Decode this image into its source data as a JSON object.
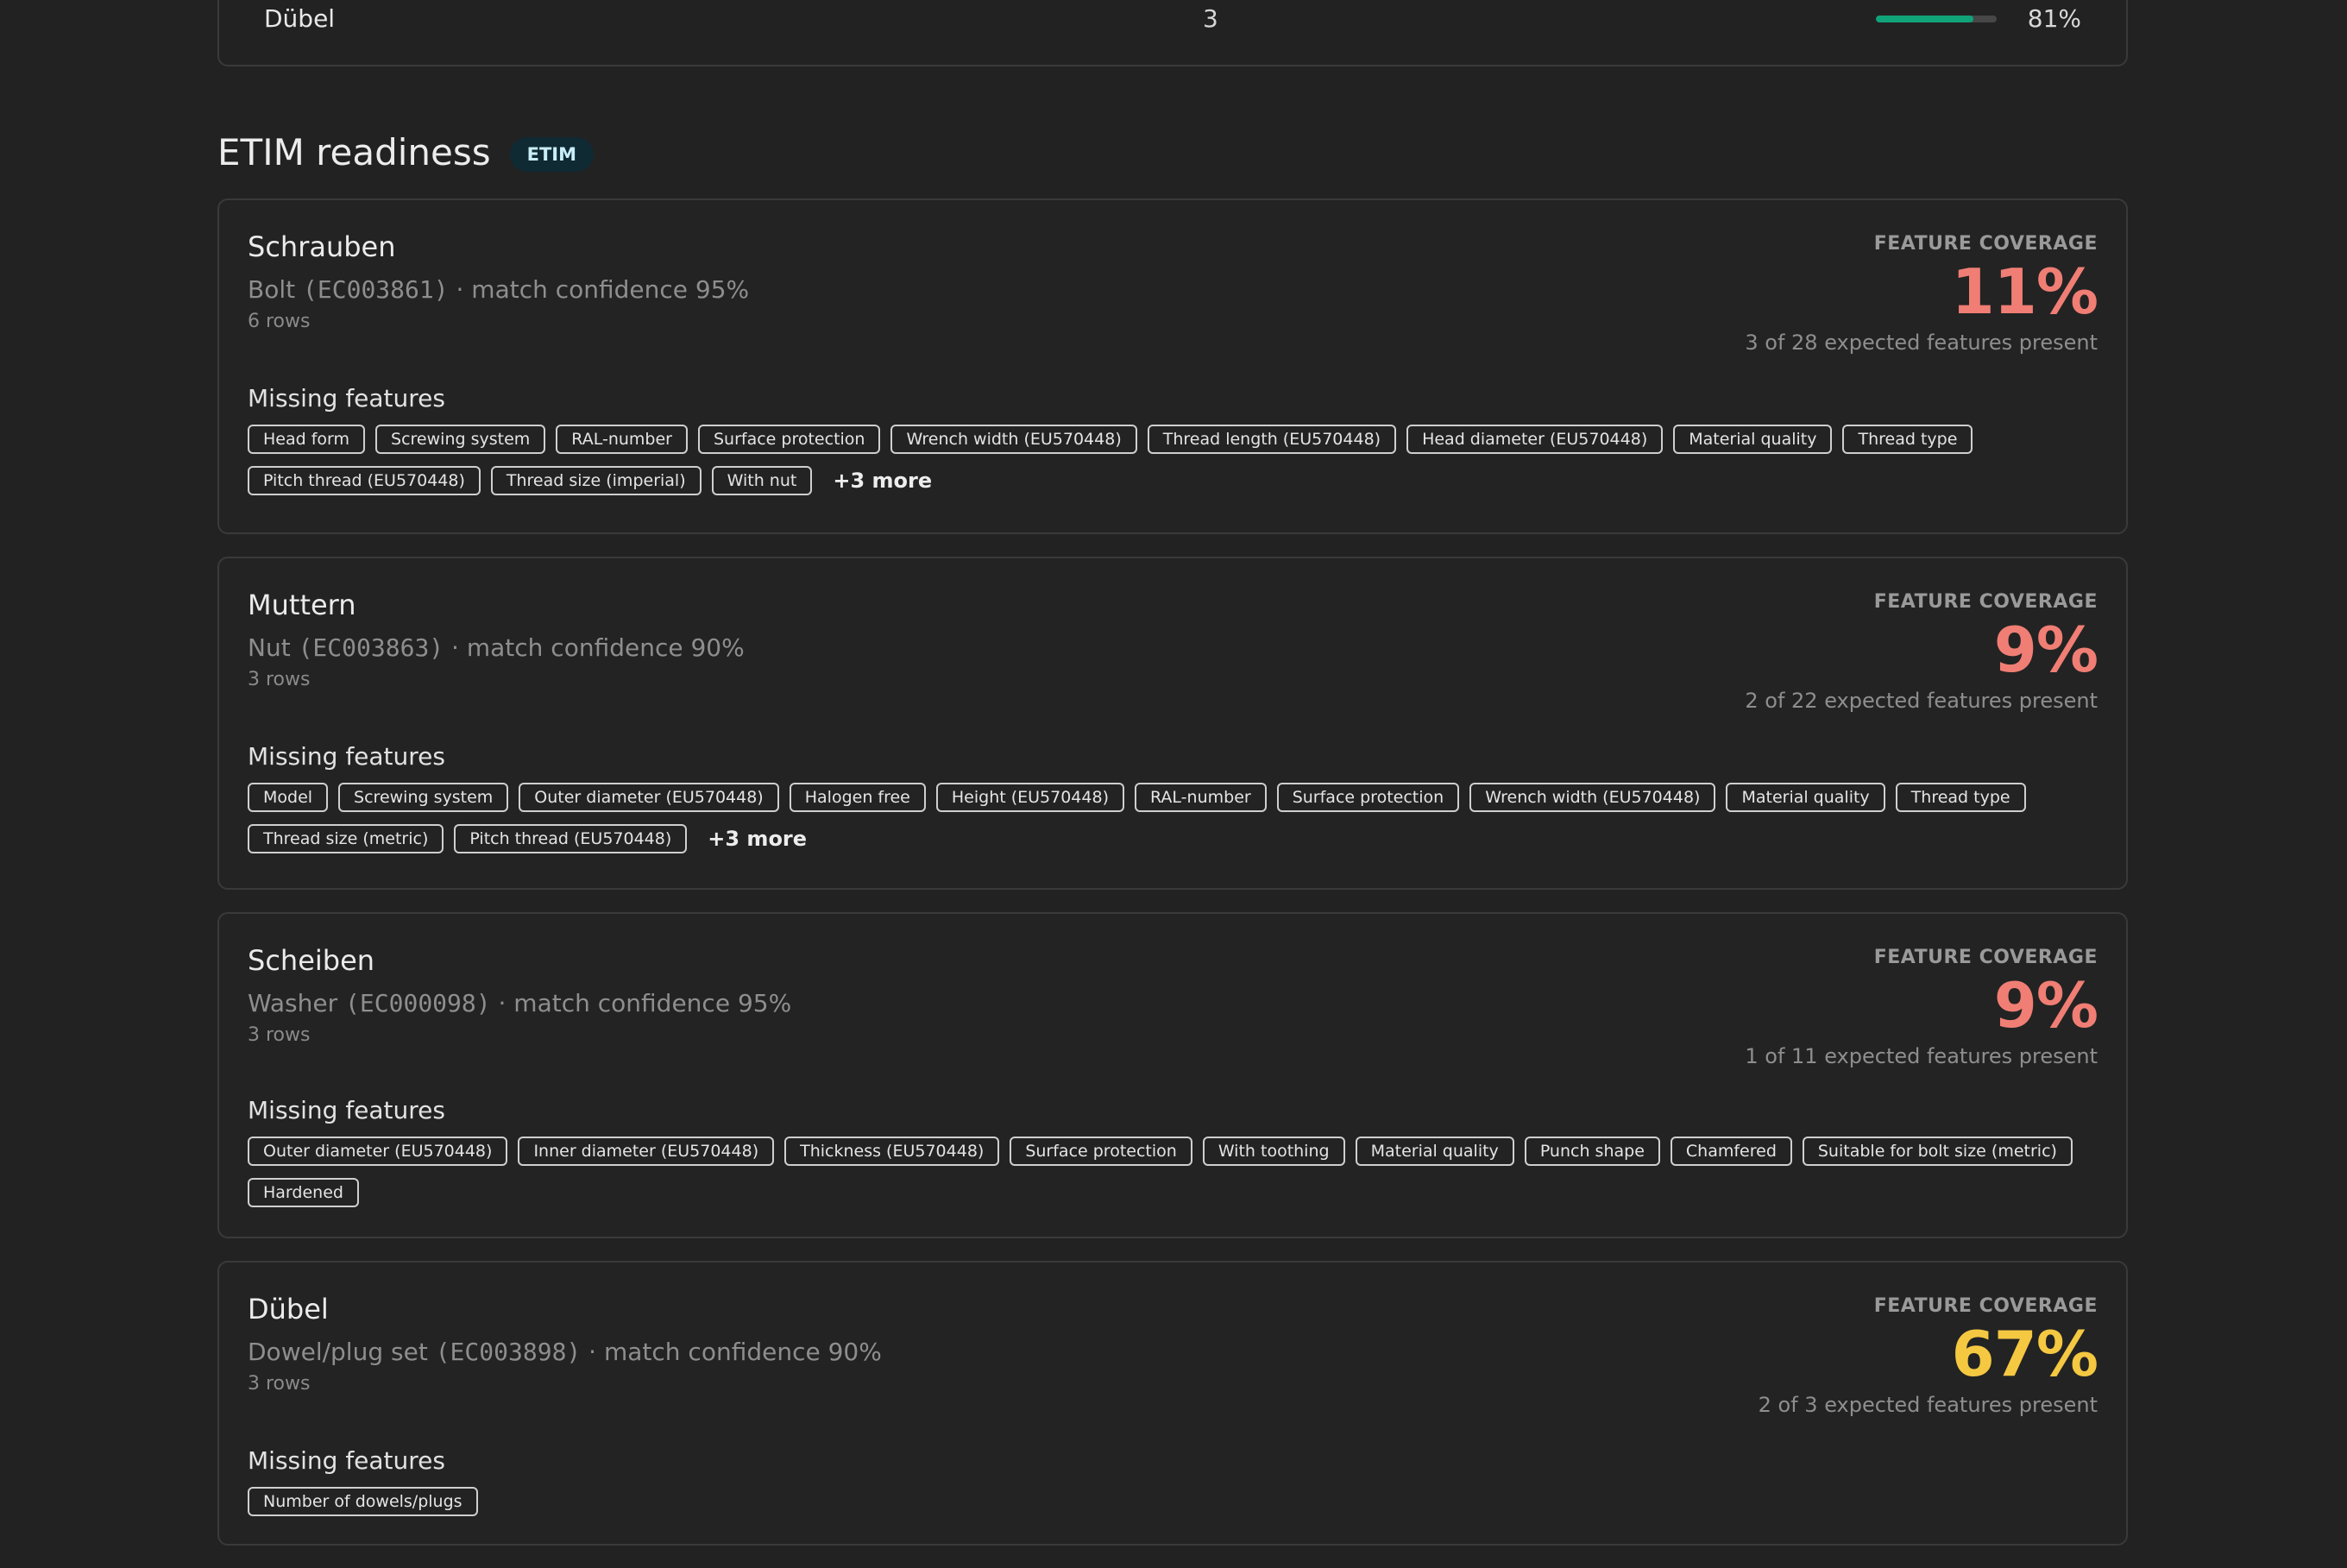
{
  "top_table": {
    "row": {
      "name": "Dübel",
      "count": "3",
      "fill_percent": 81,
      "percent_label": "81%",
      "bar_color": "#10a37a"
    }
  },
  "section": {
    "title": "ETIM readiness",
    "badge": "ETIM"
  },
  "colors": {
    "low": "#f07e74",
    "medium": "#f5c842"
  },
  "cards": [
    {
      "name": "Schrauben",
      "class_name": "Bolt",
      "class_code": "(EC003861)",
      "confidence_text": " · match confidence 95%",
      "rows": "6 rows",
      "coverage_label": "FEATURE COVERAGE",
      "coverage_value": "11%",
      "coverage_color": "#f07e74",
      "coverage_sub": "3 of 28 expected features present",
      "missing_label": "Missing features",
      "missing": [
        "Head form",
        "Screwing system",
        "RAL-number",
        "Surface protection",
        "Wrench width (EU570448)",
        "Thread length (EU570448)",
        "Head diameter (EU570448)",
        "Material quality",
        "Thread type",
        "Pitch thread (EU570448)",
        "Thread size (imperial)",
        "With nut"
      ],
      "more": "+3 more"
    },
    {
      "name": "Muttern",
      "class_name": "Nut",
      "class_code": "(EC003863)",
      "confidence_text": " · match confidence 90%",
      "rows": "3 rows",
      "coverage_label": "FEATURE COVERAGE",
      "coverage_value": "9%",
      "coverage_color": "#f07e74",
      "coverage_sub": "2 of 22 expected features present",
      "missing_label": "Missing features",
      "missing": [
        "Model",
        "Screwing system",
        "Outer diameter (EU570448)",
        "Halogen free",
        "Height (EU570448)",
        "RAL-number",
        "Surface protection",
        "Wrench width (EU570448)",
        "Material quality",
        "Thread type",
        "Thread size (metric)",
        "Pitch thread (EU570448)"
      ],
      "more": "+3 more"
    },
    {
      "name": "Scheiben",
      "class_name": "Washer",
      "class_code": "(EC000098)",
      "confidence_text": " · match confidence 95%",
      "rows": "3 rows",
      "coverage_label": "FEATURE COVERAGE",
      "coverage_value": "9%",
      "coverage_color": "#f07e74",
      "coverage_sub": "1 of 11 expected features present",
      "missing_label": "Missing features",
      "missing": [
        "Outer diameter (EU570448)",
        "Inner diameter (EU570448)",
        "Thickness (EU570448)",
        "Surface protection",
        "With toothing",
        "Material quality",
        "Punch shape",
        "Chamfered",
        "Suitable for bolt size (metric)",
        "Hardened"
      ],
      "more": ""
    },
    {
      "name": "Dübel",
      "class_name": "Dowel/plug set",
      "class_code": "(EC003898)",
      "confidence_text": " · match confidence 90%",
      "rows": "3 rows",
      "coverage_label": "FEATURE COVERAGE",
      "coverage_value": "67%",
      "coverage_color": "#f5c842",
      "coverage_sub": "2 of 3 expected features present",
      "missing_label": "Missing features",
      "missing": [
        "Number of dowels/plugs"
      ],
      "more": ""
    }
  ]
}
